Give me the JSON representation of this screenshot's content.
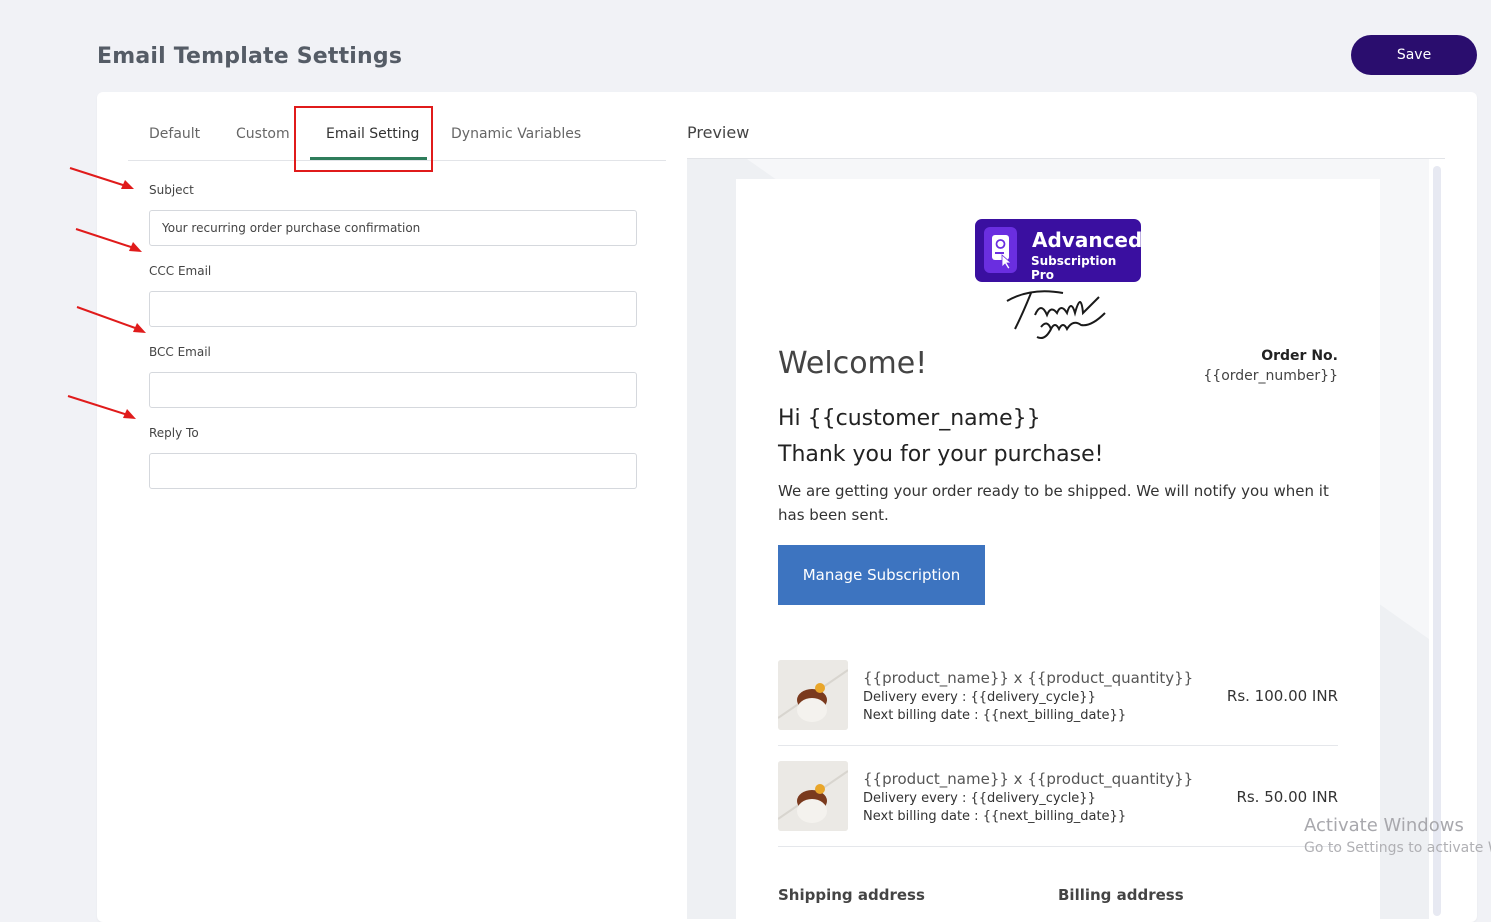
{
  "header": {
    "title": "Email Template Settings",
    "save_label": "Save"
  },
  "tabs": [
    {
      "label": "Default",
      "active": false
    },
    {
      "label": "Custom",
      "active": false
    },
    {
      "label": "Email Setting",
      "active": true
    },
    {
      "label": "Dynamic Variables",
      "active": false
    }
  ],
  "form": {
    "subject": {
      "label": "Subject",
      "value": "Your recurring order purchase confirmation"
    },
    "ccc": {
      "label": "CCC Email",
      "value": ""
    },
    "bcc": {
      "label": "BCC Email",
      "value": ""
    },
    "reply_to": {
      "label": "Reply To",
      "value": ""
    }
  },
  "preview": {
    "title": "Preview",
    "logo": {
      "title": "Advanced",
      "subtitle": "Subscription Pro"
    },
    "welcome": "Welcome!",
    "order_label": "Order No.",
    "order_number": "{{order_number}}",
    "greeting": "Hi {{customer_name}}",
    "thanks": "Thank you for your purchase!",
    "description": "We are getting your order ready to be shipped. We will notify you when it has been sent.",
    "manage_button": "Manage Subscription",
    "products": [
      {
        "name": "{{product_name}} x {{product_quantity}}",
        "delivery": "Delivery every : {{delivery_cycle}}",
        "billing": "Next billing date : {{next_billing_date}}",
        "price": "Rs. 100.00 INR"
      },
      {
        "name": "{{product_name}} x {{product_quantity}}",
        "delivery": "Delivery every : {{delivery_cycle}}",
        "billing": "Next billing date : {{next_billing_date}}",
        "price": "Rs. 50.00 INR"
      }
    ],
    "shipping_label": "Shipping address",
    "billing_label": "Billing address"
  },
  "watermark": {
    "title": "Activate Windows",
    "subtitle": "Go to Settings to activate W"
  },
  "colors": {
    "accent": "#2a0d6e",
    "tab_underline": "#2e7d5b",
    "annotation": "#e01b1b",
    "button": "#3d74c0"
  }
}
